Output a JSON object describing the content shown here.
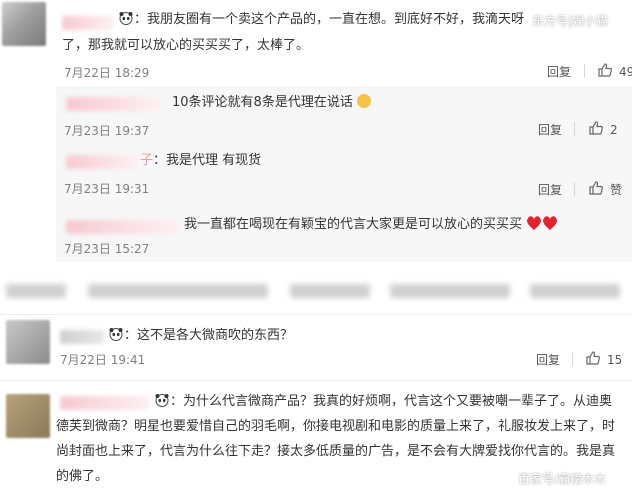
{
  "watermark_top": "东方号|娱小猫",
  "watermark_bottom": "百家号/霸榜木木",
  "actions": {
    "reply": "回复",
    "like": "赞"
  },
  "comments": [
    {
      "line1": "：我朋友圈有一个卖这个产品的，一直在想。到底好不好，我滴天呀",
      "line2": "了，那我就可以放心的买买买了，太棒了。",
      "time": "7月22日 18:29",
      "likes": "49"
    },
    {
      "text": "：这不是各大微商吹的东西？",
      "time": "7月22日 19:41",
      "likes": "15"
    },
    {
      "line1": "：为什么代言微商产品？我真的好烦啊，代言这个又要被嘲一辈子了。从迪奥",
      "line2": "德芙到微商？明星也要爱惜自己的羽毛啊，你接电视剧和电影的质量上来了，礼服妆发上来了，时",
      "line3": "尚封面也上来了，代言为什么往下走？接太多低质量的广告，是不会有大牌爱找你代言的。我是真",
      "line4": "的佛了。"
    }
  ],
  "replies": [
    {
      "text": "10条评论就有8条是代理在说话",
      "time": "7月23日 19:37",
      "likes": "2"
    },
    {
      "prefix": "子",
      "text": "：我是代理 有现货",
      "time": "7月23日 19:31",
      "likes": ""
    },
    {
      "text": "我一直都在喝现在有颖宝的代言大家更是可以放心的买买买",
      "time": "7月23日 15:27"
    }
  ]
}
